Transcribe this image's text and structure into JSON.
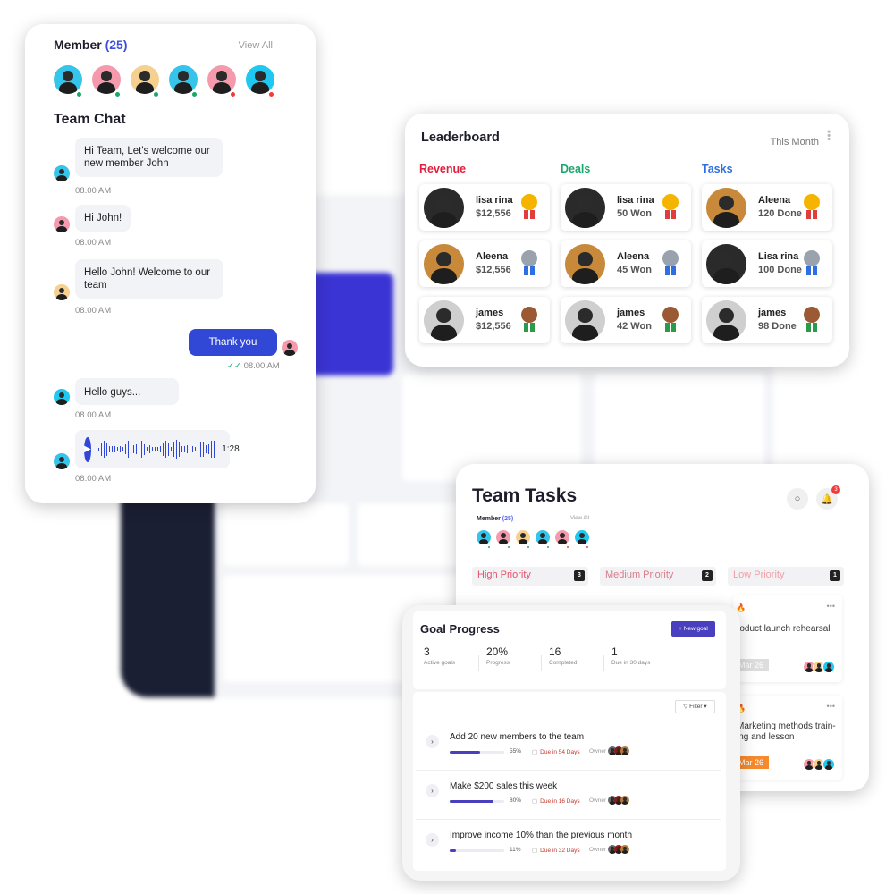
{
  "colors": {
    "accent": "#3148d6",
    "revenue": "#e0213f",
    "deals": "#17a86b",
    "tasks": "#2f6fe0",
    "goal_accent": "#4a3fbf",
    "due": "#c0392b"
  },
  "chat_card": {
    "member_label": "Member",
    "member_count": "(25)",
    "view_all": "View All",
    "members": [
      {
        "bg": "#35c5ea",
        "status": "online"
      },
      {
        "bg": "#f59aac",
        "status": "online"
      },
      {
        "bg": "#f6d08f",
        "status": "online"
      },
      {
        "bg": "#35c5ea",
        "status": "online"
      },
      {
        "bg": "#f59aac",
        "status": "busy"
      },
      {
        "bg": "#1ec8f0",
        "status": "busy"
      }
    ],
    "title": "Team Chat",
    "messages": [
      {
        "text": "Hi Team, Let's welcome our new member John",
        "time": "08.00 AM"
      },
      {
        "text": "Hi John!",
        "time": "08.00 AM"
      },
      {
        "text": "Hello John! Welcome to our team",
        "time": "08.00 AM"
      },
      {
        "text": "Thank you",
        "time": "08.00 AM",
        "mine": true,
        "read_icon": "double-check-icon"
      },
      {
        "text": "Hello guys...",
        "time": "08.00 AM"
      },
      {
        "voice_duration": "1:28",
        "time": "08.00 AM",
        "icon": "play-icon"
      }
    ]
  },
  "leaderboard": {
    "title": "Leaderboard",
    "period": "This Month",
    "columns": [
      {
        "title": "Revenue",
        "rows": [
          {
            "name": "lisa rina",
            "value": "$12,556",
            "medal": "gold"
          },
          {
            "name": "Aleena",
            "value": "$12,556",
            "medal": "silver"
          },
          {
            "name": "james",
            "value": "$12,556",
            "medal": "bronze"
          }
        ]
      },
      {
        "title": "Deals",
        "rows": [
          {
            "name": "lisa rina",
            "value": "50 Won",
            "medal": "gold"
          },
          {
            "name": "Aleena",
            "value": "45 Won",
            "medal": "silver"
          },
          {
            "name": "james",
            "value": "42 Won",
            "medal": "bronze"
          }
        ]
      },
      {
        "title": "Tasks",
        "rows": [
          {
            "name": "Aleena",
            "value": "120 Done",
            "medal": "gold"
          },
          {
            "name": "Lisa rina",
            "value": "100 Done",
            "medal": "silver"
          },
          {
            "name": "james",
            "value": "98 Done",
            "medal": "bronze"
          }
        ]
      }
    ]
  },
  "team_tasks": {
    "title": "Team Tasks",
    "notification_count": "3",
    "member_label": "Member",
    "member_count": "(25)",
    "view_all": "View All",
    "priorities": [
      {
        "label": "High Priority",
        "count": "3"
      },
      {
        "label": "Medium Priority",
        "count": "2"
      },
      {
        "label": "Low Priority",
        "count": "1"
      }
    ],
    "cards": [
      {
        "title": "roduct launch rehearsal",
        "date": "Mar 26"
      },
      {
        "title": "Marketing methods train-ing and lesson",
        "date": "Mar 26"
      }
    ]
  },
  "goal_progress": {
    "title": "Goal Progress",
    "new_goal": "+ New goal",
    "filter": "Filter ▾",
    "stats": [
      {
        "value": "3",
        "label": "Active goals"
      },
      {
        "value": "20%",
        "label": "Progress"
      },
      {
        "value": "16",
        "label": "Completed"
      },
      {
        "value": "1",
        "label": "Due in 30 days"
      }
    ],
    "owner_label": "Owner",
    "goals": [
      {
        "title": "Add 20 new members to the team",
        "progress": 55,
        "progress_label": "55%",
        "due": "Due in 54 Days"
      },
      {
        "title": "Make $200 sales this week",
        "progress": 80,
        "progress_label": "80%",
        "due": "Due in 16 Days"
      },
      {
        "title": "Improve income 10% than the previous month",
        "progress": 11,
        "progress_label": "11%",
        "due": "Due in 32 Days"
      }
    ]
  }
}
